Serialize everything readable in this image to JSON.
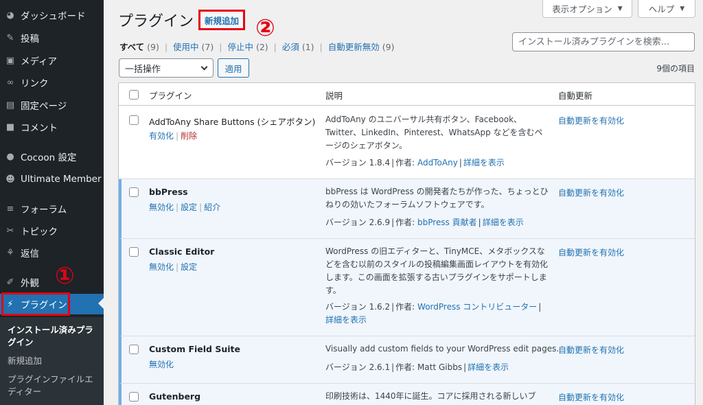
{
  "sidebar": {
    "items": [
      {
        "label": "ダッシュボード",
        "icon": "dashboard-icon"
      },
      {
        "label": "投稿",
        "icon": "pin-icon"
      },
      {
        "label": "メディア",
        "icon": "media-icon"
      },
      {
        "label": "リンク",
        "icon": "link-icon"
      },
      {
        "label": "固定ページ",
        "icon": "page-icon"
      },
      {
        "label": "コメント",
        "icon": "comment-icon"
      },
      {
        "label": "Cocoon 設定",
        "icon": "circle-icon"
      },
      {
        "label": "Ultimate Member",
        "icon": "user-icon"
      },
      {
        "label": "フォーラム",
        "icon": "forum-icon"
      },
      {
        "label": "トピック",
        "icon": "topic-icon"
      },
      {
        "label": "返信",
        "icon": "reply-icon"
      },
      {
        "label": "外観",
        "icon": "appearance-icon"
      },
      {
        "label": "プラグイン",
        "icon": "plugin-icon"
      }
    ],
    "submenu": [
      {
        "label": "インストール済みプラグイン"
      },
      {
        "label": "新規追加"
      },
      {
        "label": "プラグインファイルエディター"
      }
    ]
  },
  "annotations": {
    "one": "①",
    "two": "②",
    "color": "#e60012"
  },
  "header": {
    "title": "プラグイン",
    "add_new": "新規追加",
    "screen_options": "表示オプション",
    "help": "ヘルプ"
  },
  "filters": [
    {
      "label": "すべて",
      "count": "(9)"
    },
    {
      "label": "使用中",
      "count": "(7)"
    },
    {
      "label": "停止中",
      "count": "(2)"
    },
    {
      "label": "必須",
      "count": "(1)"
    },
    {
      "label": "自動更新無効",
      "count": "(9)"
    }
  ],
  "search": {
    "placeholder": "インストール済みプラグインを検索..."
  },
  "bulk": {
    "selected": "一括操作",
    "apply": "適用",
    "count": "9個の項目"
  },
  "table": {
    "headers": {
      "plugin": "プラグイン",
      "description": "説明",
      "auto": "自動更新"
    },
    "rows": [
      {
        "name": "AddToAny Share Buttons (シェアボタン)",
        "actions": [
          "有効化",
          "削除"
        ],
        "desc": "AddToAny のユニバーサル共有ボタン、Facebook、Twitter、LinkedIn、Pinterest、WhatsApp などを含むページのシェアボタン。",
        "version": "バージョン 1.8.4",
        "author_label": "作者:",
        "author": "AddToAny",
        "details": "詳細を表示",
        "auto": "自動更新を有効化"
      },
      {
        "name": "bbPress",
        "actions": [
          "無効化",
          "設定",
          "紹介"
        ],
        "desc": "bbPress は WordPress の開発者たちが作った、ちょっとひねりの効いたフォーラムソフトウェアです。",
        "version": "バージョン 2.6.9",
        "author_label": "作者:",
        "author": "bbPress 貢献者",
        "details": "詳細を表示",
        "auto": "自動更新を有効化"
      },
      {
        "name": "Classic Editor",
        "actions": [
          "無効化",
          "設定"
        ],
        "desc": "WordPress の旧エディターと、TinyMCE、メタボックスなどを含む以前のスタイルの投稿編集画面レイアウトを有効化します。この画面を拡張する古いプラグインをサポートします。",
        "version": "バージョン 1.6.2",
        "author_label": "作者:",
        "author": "WordPress コントリビューター",
        "details": "詳細を表示",
        "auto": "自動更新を有効化"
      },
      {
        "name": "Custom Field Suite",
        "actions": [
          "無効化"
        ],
        "desc": "Visually add custom fields to your WordPress edit pages.",
        "version": "バージョン 2.6.1",
        "author_label": "作者:",
        "author": "Matt Gibbs",
        "details": "詳細を表示",
        "auto": "自動更新を有効化"
      },
      {
        "name": "Gutenberg",
        "actions": [],
        "desc": "印刷技術は、1440年に誕生。コアに採用される新しいブ",
        "auto": "自動更新を有効化"
      }
    ]
  }
}
